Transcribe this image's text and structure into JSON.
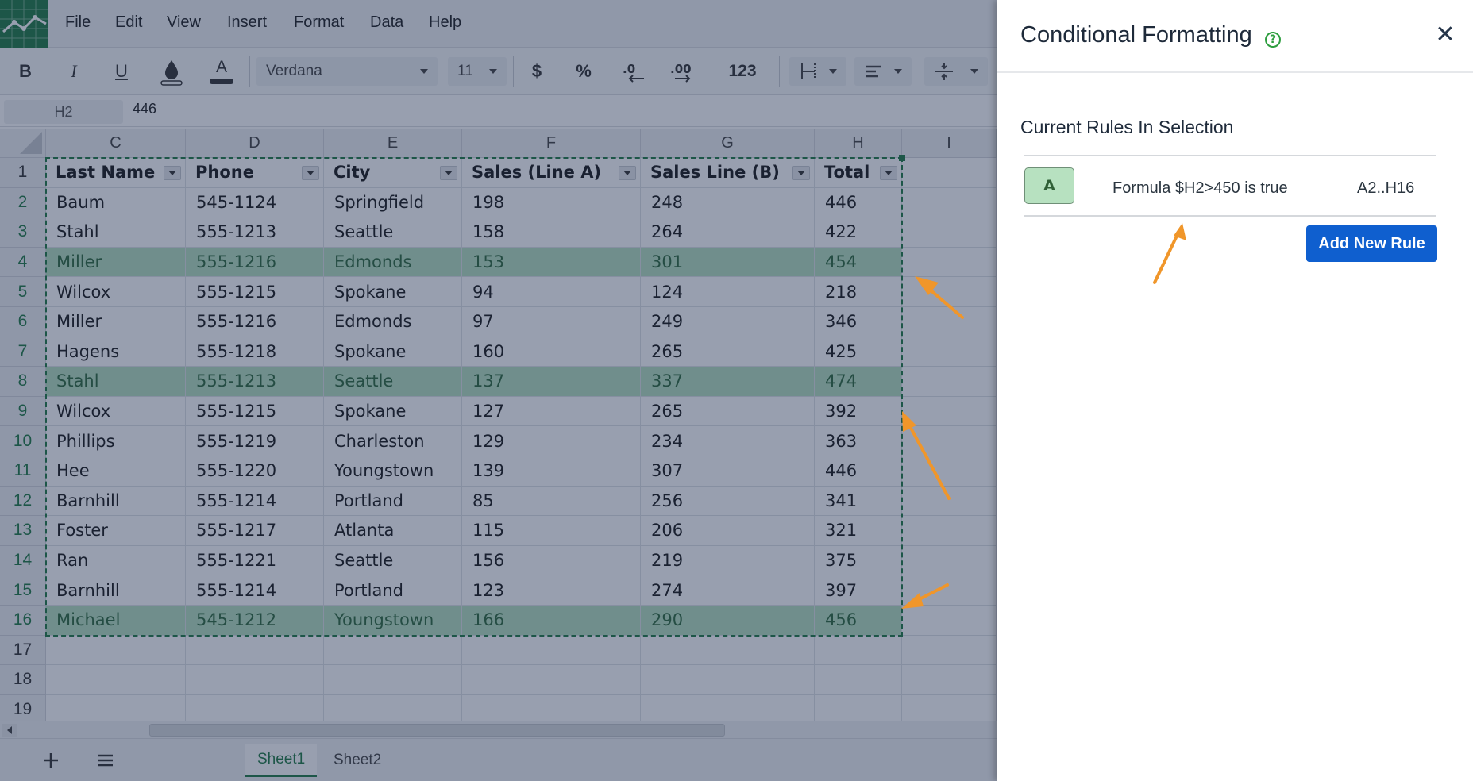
{
  "menu": [
    "File",
    "Edit",
    "View",
    "Insert",
    "Format",
    "Data",
    "Help"
  ],
  "toolbar": {
    "bold": "B",
    "italic": "I",
    "underline": "U",
    "text_color": "A",
    "font_name": "Verdana",
    "font_size": "11",
    "currency": "$",
    "percent": "%",
    "decrease_decimals": ".0",
    "increase_decimals": ".00",
    "number_format": "123"
  },
  "formula_bar": {
    "cell_ref": "H2",
    "value": "446"
  },
  "columns": [
    "C",
    "D",
    "E",
    "F",
    "G",
    "H",
    "I"
  ],
  "rows": [
    "1",
    "2",
    "3",
    "4",
    "5",
    "6",
    "7",
    "8",
    "9",
    "10",
    "11",
    "12",
    "13",
    "14",
    "15",
    "16",
    "17",
    "18",
    "19"
  ],
  "table": {
    "headers": [
      "Last Name",
      "Phone",
      "City",
      "Sales (Line A)",
      "Sales Line (B)",
      "Total"
    ],
    "rows": [
      {
        "cells": [
          "Baum",
          "545-1124",
          "Springfield",
          "198",
          "248",
          "446"
        ],
        "highlight": false
      },
      {
        "cells": [
          "Stahl",
          "555-1213",
          "Seattle",
          "158",
          "264",
          "422"
        ],
        "highlight": false
      },
      {
        "cells": [
          "Miller",
          "555-1216",
          "Edmonds",
          "153",
          "301",
          "454"
        ],
        "highlight": true
      },
      {
        "cells": [
          "Wilcox",
          "555-1215",
          "Spokane",
          "94",
          "124",
          "218"
        ],
        "highlight": false
      },
      {
        "cells": [
          "Miller",
          "555-1216",
          "Edmonds",
          "97",
          "249",
          "346"
        ],
        "highlight": false
      },
      {
        "cells": [
          "Hagens",
          "555-1218",
          "Spokane",
          "160",
          "265",
          "425"
        ],
        "highlight": false
      },
      {
        "cells": [
          "Stahl",
          "555-1213",
          "Seattle",
          "137",
          "337",
          "474"
        ],
        "highlight": true
      },
      {
        "cells": [
          "Wilcox",
          "555-1215",
          "Spokane",
          "127",
          "265",
          "392"
        ],
        "highlight": false
      },
      {
        "cells": [
          "Phillips",
          "555-1219",
          "Charleston",
          "129",
          "234",
          "363"
        ],
        "highlight": false
      },
      {
        "cells": [
          "Hee",
          "555-1220",
          "Youngstown",
          "139",
          "307",
          "446"
        ],
        "highlight": false
      },
      {
        "cells": [
          "Barnhill",
          "555-1214",
          "Portland",
          "85",
          "256",
          "341"
        ],
        "highlight": false
      },
      {
        "cells": [
          "Foster",
          "555-1217",
          "Atlanta",
          "115",
          "206",
          "321"
        ],
        "highlight": false
      },
      {
        "cells": [
          "Ran",
          "555-1221",
          "Seattle",
          "156",
          "219",
          "375"
        ],
        "highlight": false
      },
      {
        "cells": [
          "Barnhill",
          "555-1214",
          "Portland",
          "123",
          "274",
          "397"
        ],
        "highlight": false
      },
      {
        "cells": [
          "Michael",
          "545-1212",
          "Youngstown",
          "166",
          "290",
          "456"
        ],
        "highlight": true
      }
    ]
  },
  "sheets": [
    "Sheet1",
    "Sheet2"
  ],
  "active_sheet": "Sheet1",
  "panel": {
    "title": "Conditional Formatting",
    "help_icon": "?",
    "close_icon": "✕",
    "rules_heading": "Current Rules In Selection",
    "rules": [
      {
        "swatch_label": "A",
        "description": "Formula $H2>450 is true",
        "range": "A2..H16"
      }
    ],
    "add_rule_label": "Add New Rule"
  },
  "colors": {
    "brand": "#1f7a44",
    "highlight_fill": "#b7e1c0",
    "highlight_text": "#2f6a3c",
    "overlay": "#1b2b4e",
    "primary_button": "#0f5fcf",
    "arrow": "#f0962a"
  }
}
